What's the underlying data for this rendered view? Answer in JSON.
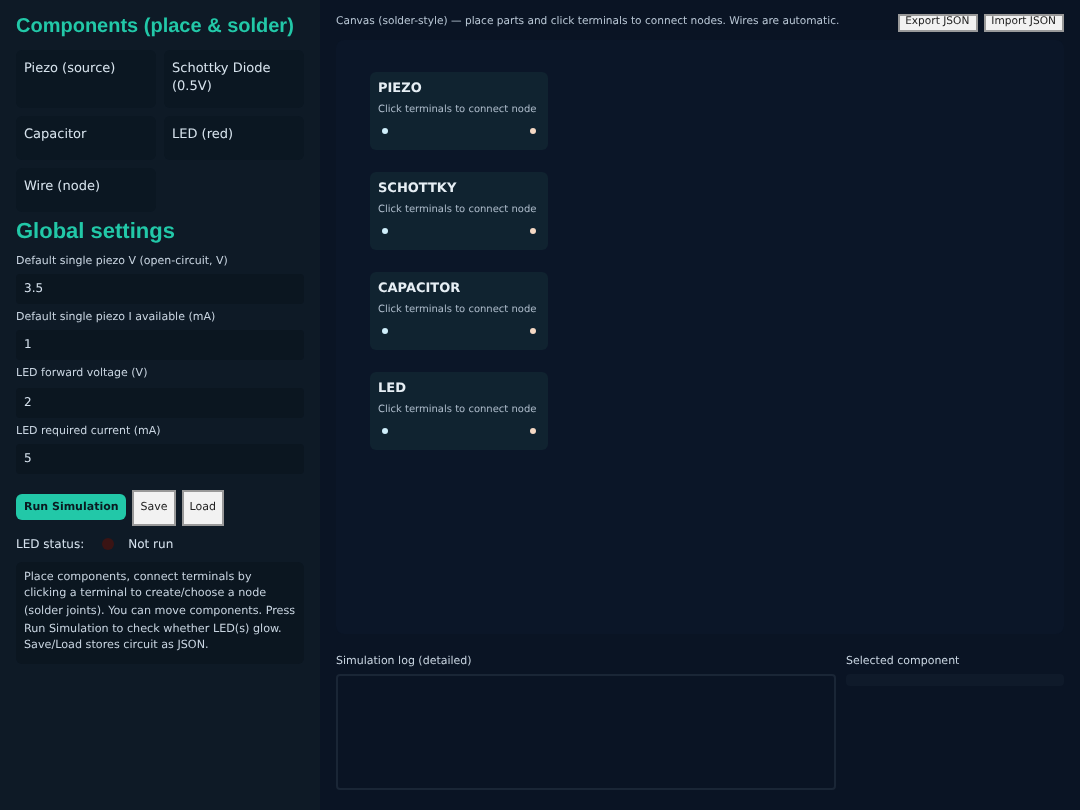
{
  "components": {
    "title": "Components (place & solder)",
    "items": [
      {
        "label": "Piezo (source)"
      },
      {
        "label": "Schottky Diode (0.5V)"
      },
      {
        "label": "Capacitor"
      },
      {
        "label": "LED (red)"
      },
      {
        "label": "Wire (node)"
      }
    ]
  },
  "settings": {
    "title": "Global settings",
    "fields": [
      {
        "label": "Default single piezo V (open-circuit, V)",
        "value": "3.5"
      },
      {
        "label": "Default single piezo I available (mA)",
        "value": "1"
      },
      {
        "label": "LED forward voltage (V)",
        "value": "2"
      },
      {
        "label": "LED required current (mA)",
        "value": "5"
      }
    ]
  },
  "actions": {
    "run": "Run Simulation",
    "save": "Save",
    "load": "Load"
  },
  "led_status": {
    "label": "LED status:",
    "lit": false,
    "text": "Not run"
  },
  "help": "Place components, connect terminals by clicking a terminal to create/choose a node (solder joints). You can move components. Press Run Simulation to check whether LED(s) glow. Save/Load stores circuit as JSON.",
  "canvas": {
    "caption": "Canvas (solder-style) — place parts and click terminals to connect nodes. Wires are automatic.",
    "export": "Export JSON",
    "import": "Import JSON",
    "parts": [
      {
        "name": "PIEZO",
        "hint": "Click terminals to connect node"
      },
      {
        "name": "SCHOTTKY",
        "hint": "Click terminals to connect node"
      },
      {
        "name": "CAPACITOR",
        "hint": "Click terminals to connect node"
      },
      {
        "name": "LED",
        "hint": "Click terminals to connect node"
      }
    ]
  },
  "log": {
    "label": "Simulation log (detailed)"
  },
  "selected": {
    "label": "Selected component"
  }
}
